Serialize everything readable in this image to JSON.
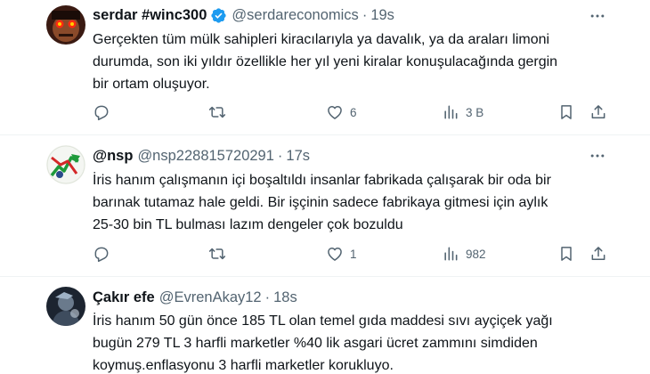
{
  "tweets": [
    {
      "name": "serdar #winc300",
      "handle": "@serdareconomics",
      "separator": "·",
      "time": "19s",
      "verified": true,
      "text_lines": [
        "Gerçekten tüm mülk sahipleri kiracılarıyla ya davalık, ya da araları limoni",
        "durumda, son iki yıldır özellikle her yıl yeni kiralar konuşulacağında gergin",
        "bir ortam oluşuyor."
      ],
      "likes": "6",
      "views": "3 B"
    },
    {
      "name": "@nsp",
      "handle": "@nsp228815720291",
      "separator": "·",
      "time": "17s",
      "verified": false,
      "text_lines": [
        "İris hanım çalışmanın içi boşaltıldı insanlar fabrikada çalışarak bir oda bir",
        "barınak tutamaz hale geldi. Bir işçinin sadece fabrikaya gitmesi için aylık",
        "25-30 bin TL bulması lazım dengeler çok bozuldu"
      ],
      "likes": "1",
      "views": "982"
    },
    {
      "name": "Çakır efe",
      "handle": "@EvrenAkay12",
      "separator": "·",
      "time": "18s",
      "verified": false,
      "text_lines": [
        "İris hanım 50 gün önce 185 TL olan temel gıda maddesi sıvı ayçiçek yağı",
        "bugün 279 TL 3 harfli marketler %40 lik asgari ücret zammını simdiden",
        "koymuş.enflasyonu 3 harfli marketler korukluyo."
      ]
    }
  ],
  "colors": {
    "text": "#0f1419",
    "secondary": "#536471",
    "verified": "#1d9bf0",
    "divider": "#eff3f4"
  },
  "icons": [
    "reply-icon",
    "retweet-icon",
    "like-icon",
    "views-icon",
    "bookmark-icon",
    "share-icon",
    "more-icon",
    "verified-badge-icon"
  ]
}
